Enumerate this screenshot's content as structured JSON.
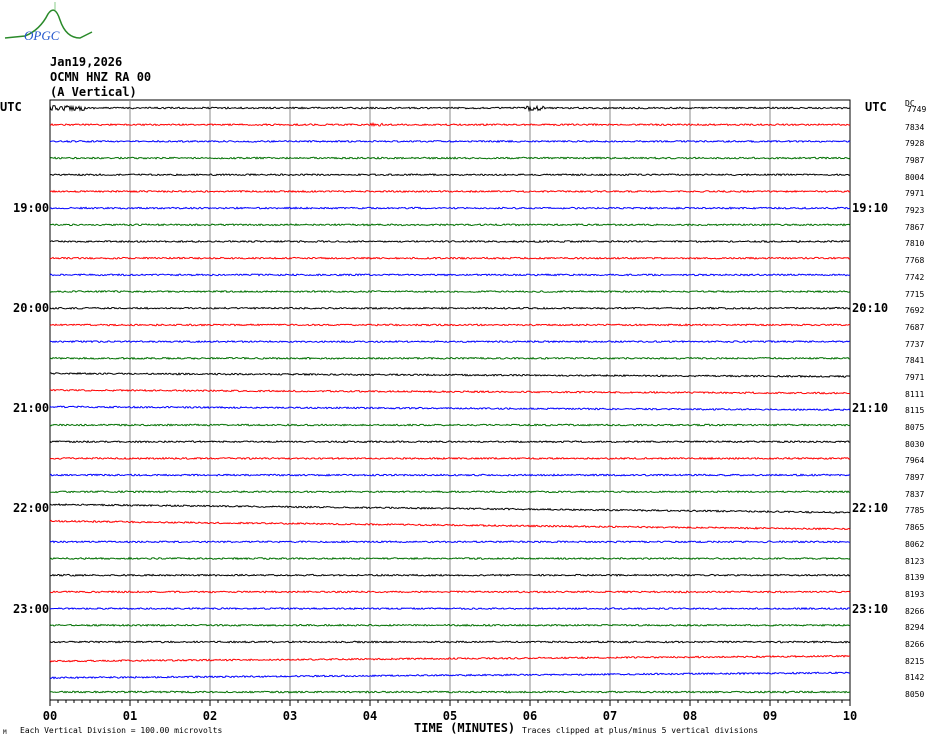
{
  "logo_text": "OPGC",
  "header": {
    "date": "Jan19,2026",
    "station": "OCMN HNZ RA 00",
    "component": "(A Vertical)"
  },
  "utc_label_left": "UTC",
  "utc_label_right": "UTC",
  "dc_label": "DC",
  "chart_data": {
    "type": "line",
    "title": "Helicorder OCMN HNZ RA 00",
    "xlabel": "TIME (MINUTES)",
    "x_ticks": [
      "00",
      "01",
      "02",
      "03",
      "04",
      "05",
      "06",
      "07",
      "08",
      "09",
      "10"
    ],
    "xlim": [
      0,
      10
    ],
    "trace_colors": [
      "#000000",
      "#ff0000",
      "#0000ff",
      "#007000"
    ],
    "left_time_labels": [
      {
        "trace": 6,
        "label": "19:00"
      },
      {
        "trace": 12,
        "label": "20:00"
      },
      {
        "trace": 18,
        "label": "21:00"
      },
      {
        "trace": 24,
        "label": "22:00"
      },
      {
        "trace": 30,
        "label": "23:00"
      }
    ],
    "right_time_labels": [
      {
        "trace": 6,
        "label": "19:10"
      },
      {
        "trace": 12,
        "label": "20:10"
      },
      {
        "trace": 18,
        "label": "21:10"
      },
      {
        "trace": 24,
        "label": "22:10"
      },
      {
        "trace": 30,
        "label": "23:10"
      }
    ],
    "dc_offsets": [
      "7749",
      "7834",
      "7928",
      "7987",
      "8004",
      "7971",
      "7923",
      "7867",
      "7810",
      "7768",
      "7742",
      "7715",
      "7692",
      "7687",
      "7737",
      "7841",
      "7971",
      "8111",
      "8115",
      "8075",
      "8030",
      "7964",
      "7897",
      "7837",
      "7785",
      "7865",
      "8062",
      "8123",
      "8139",
      "8193",
      "8266",
      "8294",
      "8266",
      "8215",
      "8142",
      "8050"
    ],
    "footer_left": "Each Vertical Division =  100.00 microvolts",
    "footer_right": "Traces clipped at plus/minus 5 vertical divisions",
    "corner_mark": "M"
  }
}
